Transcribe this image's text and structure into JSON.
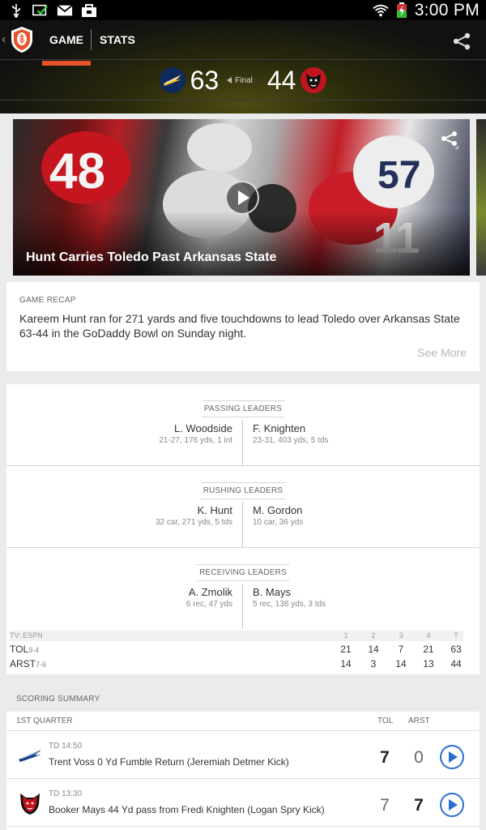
{
  "status_bar": {
    "time": "3:00 PM"
  },
  "header": {
    "tabs": [
      {
        "label": "GAME",
        "active": true
      },
      {
        "label": "STATS",
        "active": false
      }
    ],
    "game_status": "Final",
    "home": {
      "abbr": "TOL",
      "score": "63",
      "color": "#0f2a5c"
    },
    "away": {
      "abbr": "ARST",
      "score": "44",
      "color": "#c1141c"
    },
    "accent": "#e8522b"
  },
  "video": {
    "title": "Hunt Carries Toledo Past Arkansas State"
  },
  "recap": {
    "label": "GAME RECAP",
    "text": "Kareem Hunt ran for 271 yards and five touchdowns to lead Toledo over Arkansas State 63-44 in the GoDaddy Bowl on Sunday night.",
    "see_more": "See More"
  },
  "leaders": [
    {
      "category": "PASSING LEADERS",
      "left": {
        "name": "L. Woodside",
        "stat": "21-27, 176 yds,  1 int"
      },
      "right": {
        "name": "F. Knighten",
        "stat": "23-31, 403 yds, 5 tds"
      }
    },
    {
      "category": "RUSHING LEADERS",
      "left": {
        "name": "K. Hunt",
        "stat": "32 car, 271 yds, 5 tds"
      },
      "right": {
        "name": "M. Gordon",
        "stat": "10 car, 36 yds"
      }
    },
    {
      "category": "RECEIVING LEADERS",
      "left": {
        "name": "A. Zmolik",
        "stat": "6 rec, 47 yds"
      },
      "right": {
        "name": "B. Mays",
        "stat": "5 rec, 138 yds, 3 tds"
      }
    }
  ],
  "box_score": {
    "tv": "TV: ESPN",
    "columns": [
      "1",
      "2",
      "3",
      "4",
      "T"
    ],
    "rows": [
      {
        "team": "TOL",
        "record": "9-4",
        "scores": [
          "21",
          "14",
          "7",
          "21",
          "63"
        ]
      },
      {
        "team": "ARST",
        "record": "7-6",
        "scores": [
          "14",
          "3",
          "14",
          "13",
          "44"
        ]
      }
    ]
  },
  "scoring_summary": {
    "title": "SCORING SUMMARY",
    "quarter": "1ST QUARTER",
    "col1": "TOL",
    "col2": "ARST",
    "plays": [
      {
        "time": "TD 14:50",
        "desc": "Trent Voss 0 Yd Fumble Return (Jeremiah Detmer Kick)",
        "tol": "7",
        "arst": "0",
        "team": "TOL"
      },
      {
        "time": "TD 13:30",
        "desc": "Booker Mays 44 Yd pass from Fredi Knighten (Logan Spry Kick)",
        "tol": "7",
        "arst": "7",
        "team": "ARST"
      }
    ]
  }
}
